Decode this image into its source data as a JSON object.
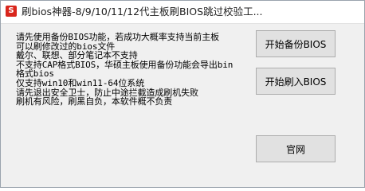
{
  "window": {
    "title": "刷bios神器-8/9/10/11/12代主板刷BIOS跳过校验工...",
    "app_icon_glyph": "S",
    "app_icon_color": "#d9261c"
  },
  "info_lines": [
    "请先使用备份BIOS功能，若成功大概率支持当前主板",
    "可以刷修改过的bios文件",
    "戴尔、联想、部分笔记本不支持",
    "不支持CAP格式BIOS，华硕主板使用备份功能会导出bin",
    "格式bios",
    "仅支持win10和win11-64位系统",
    "请先退出安全卫士，防止中途拦截造成刷机失败",
    "刷机有风险，刷黑自负，本软件概不负责"
  ],
  "buttons": {
    "backup_label": "开始备份BIOS",
    "flash_label": "开始刷入BIOS",
    "website_label": "官网"
  }
}
